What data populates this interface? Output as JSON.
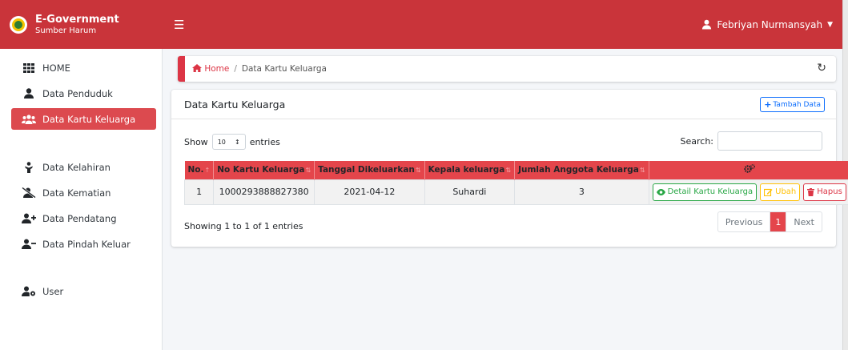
{
  "brand": {
    "title": "E-Government",
    "subtitle": "Sumber Harum"
  },
  "navbar": {
    "menu_icon": "hamburger-icon",
    "user_name": "Febriyan Nurmansyah"
  },
  "sidebar": {
    "items": [
      {
        "label": "HOME",
        "icon": "grid-icon",
        "active": false
      },
      {
        "label": "Data Penduduk",
        "icon": "user-icon",
        "active": false
      },
      {
        "label": "Data Kartu Keluarga",
        "icon": "users-icon",
        "active": true
      },
      {
        "label": "Data Kelahiran",
        "icon": "baby-icon",
        "active": false
      },
      {
        "label": "Data Kematian",
        "icon": "user-slash-icon",
        "active": false
      },
      {
        "label": "Data Pendatang",
        "icon": "user-plus-icon",
        "active": false
      },
      {
        "label": "Data Pindah Keluar",
        "icon": "user-minus-icon",
        "active": false
      },
      {
        "label": "User",
        "icon": "user-cog-icon",
        "active": false
      }
    ]
  },
  "breadcrumb": {
    "home": "Home",
    "separator": "/",
    "current": "Data Kartu Keluarga"
  },
  "card": {
    "title": "Data Kartu Keluarga",
    "add_button": "Tambah Data"
  },
  "datatable": {
    "show_label": "Show",
    "length_value": "10",
    "entries_label": "entries",
    "search_label": "Search:",
    "search_value": "",
    "columns": [
      "No.",
      "No Kartu Keluarga",
      "Tanggal Dikeluarkan",
      "Kepala keluarga",
      "Jumlah Anggota Keluarga",
      ""
    ],
    "rows": [
      {
        "no": "1",
        "no_kk": "1000293888827380",
        "tanggal": "2021-04-12",
        "kepala": "Suhardi",
        "jumlah": "3"
      }
    ],
    "actions": {
      "detail": "Detail Kartu Keluarga",
      "ubah": "Ubah",
      "hapus": "Hapus"
    },
    "info": "Showing 1 to 1 of 1 entries",
    "pagination": {
      "previous": "Previous",
      "current": "1",
      "next": "Next"
    }
  },
  "colors": {
    "primary": "#c9343a",
    "table_header": "#e4454b",
    "active_item": "#dc4a4f"
  }
}
